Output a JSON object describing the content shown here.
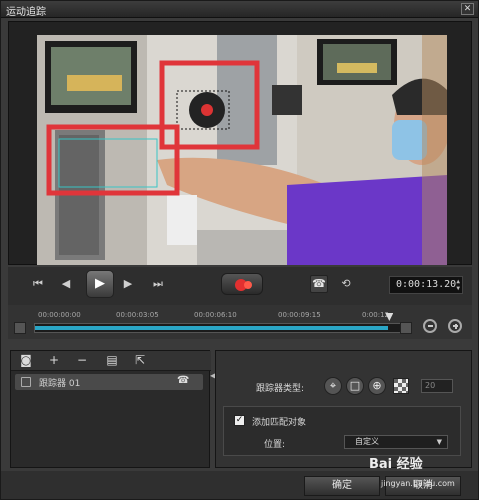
{
  "window": {
    "title": "运动追踪",
    "close_icon": "close-icon"
  },
  "playback": {
    "timecode": "0:00:13.20",
    "buttons": [
      "go-start-icon",
      "step-back-icon",
      "play-icon",
      "step-forward-icon",
      "go-end-icon",
      "record-track-icon",
      "phone-icon",
      "history-icon"
    ]
  },
  "timeline": {
    "ticks": [
      "00:00:00:00",
      "00:00:03:05",
      "00:00:06:10",
      "00:00:09:15",
      "0:00:12"
    ],
    "progress": 0.95
  },
  "tracker_list": {
    "items": [
      {
        "label": "跟踪器 01"
      }
    ]
  },
  "settings": {
    "tracker_type_label": "跟踪器类型:",
    "count_value": "20",
    "match_object_label": "添加匹配对象",
    "position_label": "位置:",
    "position_value": "自定义"
  },
  "footer": {
    "ok_label": "确定",
    "cancel_label": "取消"
  },
  "watermark": {
    "main": "Bai 经验",
    "sub": "jingyan.baidu.com"
  },
  "colors": {
    "accent": "#2aa6c6",
    "tracker_box": "#e0353a",
    "record": "#e23030"
  }
}
